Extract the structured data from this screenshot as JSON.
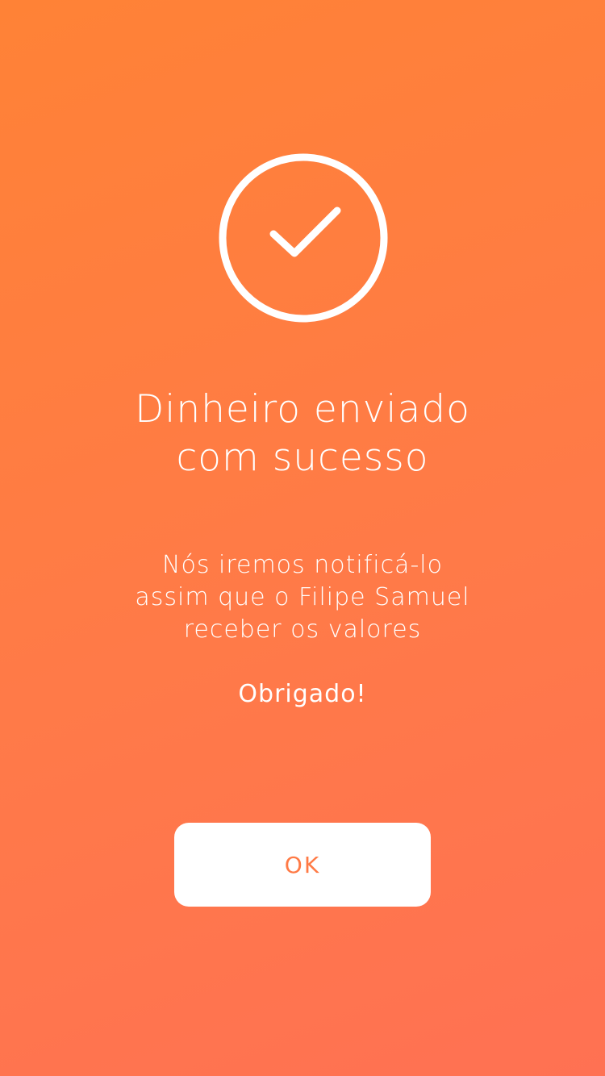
{
  "icon": {
    "name": "check-circle-icon",
    "color": "#FFFFFF"
  },
  "title": {
    "line1": "Dinheiro enviado",
    "line2": "com sucesso"
  },
  "message": {
    "line1": "Nós iremos notificá-lo",
    "line2": "assim que o Filipe Samuel",
    "line3": "receber os valores"
  },
  "thanks": "Obrigado!",
  "ok_button": {
    "label": "OK"
  },
  "colors": {
    "background_start": "#FF8236",
    "background_end": "#FF7153",
    "accent_text": "#FF7A45",
    "button_bg": "#FFFFFF",
    "foreground": "#FFFFFF"
  }
}
